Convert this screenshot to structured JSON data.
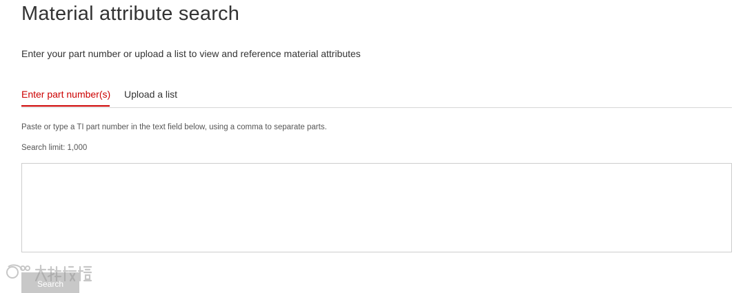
{
  "page": {
    "title": "Material attribute search",
    "intro": "Enter your part number or upload a list to view and reference material attributes"
  },
  "tabs": [
    {
      "label": "Enter part number(s)",
      "active": true
    },
    {
      "label": "Upload a list",
      "active": false
    }
  ],
  "form": {
    "help_text": "Paste or type a TI part number in the text field below, using a comma to separate parts.",
    "limit_text": "Search limit: 1,000",
    "input_value": "",
    "search_label": "Search"
  },
  "theme": {
    "accent": "#cc0000",
    "text": "#333333",
    "muted_text": "#555555",
    "divider": "#d6d6d6",
    "button_bg": "#c8c8c8"
  },
  "watermark": {
    "icon": "logo-icon"
  }
}
